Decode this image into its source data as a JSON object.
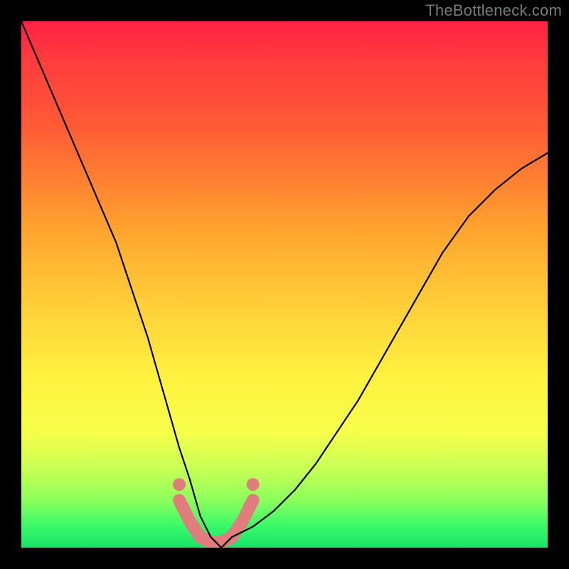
{
  "header": {
    "watermark": "TheBottleneck.com"
  },
  "colors": {
    "frame_bg": "#000000",
    "curve_stroke": "#000000",
    "accent_stroke": "#e17d7d",
    "gradient_top": "#ff2244",
    "gradient_bottom": "#1ae26a"
  },
  "chart_data": {
    "type": "line",
    "title": "",
    "xlabel": "",
    "ylabel": "",
    "xlim": [
      0,
      100
    ],
    "ylim": [
      0,
      100
    ],
    "grid": false,
    "legend": null,
    "series": [
      {
        "name": "bottleneck-curve",
        "x": [
          0,
          3,
          6,
          9,
          12,
          15,
          18,
          20,
          22,
          24,
          26,
          28,
          30,
          32,
          34,
          36,
          38,
          40,
          44,
          48,
          52,
          56,
          60,
          64,
          68,
          72,
          76,
          80,
          85,
          90,
          95,
          100
        ],
        "y": [
          100,
          93,
          86,
          79,
          72,
          65,
          58,
          52,
          46,
          40,
          33,
          26,
          19,
          13,
          6,
          2,
          0,
          2,
          4,
          7,
          11,
          16,
          22,
          28,
          35,
          42,
          49,
          56,
          63,
          68,
          72,
          75
        ]
      },
      {
        "name": "highlight-band",
        "x": [
          30,
          32,
          34,
          36,
          38,
          40,
          42,
          44
        ],
        "y": [
          9,
          5,
          2,
          1,
          1,
          2,
          5,
          9
        ]
      }
    ],
    "annotations": [
      {
        "type": "dot",
        "x": 30,
        "y": 12
      },
      {
        "type": "dot",
        "x": 44,
        "y": 12
      }
    ]
  }
}
